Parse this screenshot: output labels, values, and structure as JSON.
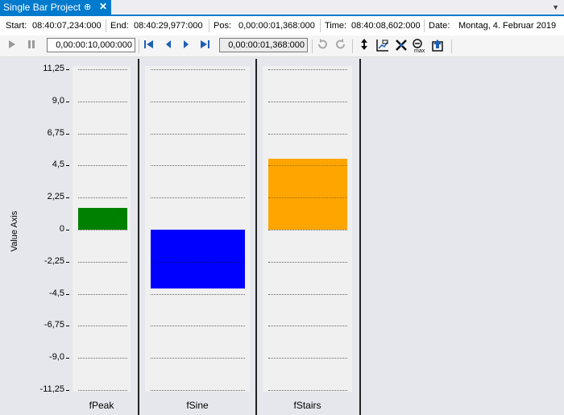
{
  "window": {
    "tab_title": "Single Bar Project",
    "pin_glyph": "⊕",
    "close_glyph": "✕",
    "menu_glyph": "▼"
  },
  "info": {
    "start_label": "Start:",
    "start_value": "08:40:07,234:000",
    "end_label": "End:",
    "end_value": "08:40:29,977:000",
    "pos_label": "Pos:",
    "pos_value": "0,00:00:01,368:000",
    "time_label": "Time:",
    "time_value": "08:40:08,602:000",
    "date_label": "Date:",
    "date_value": "Montag, 4. Februar 2019"
  },
  "toolbar": {
    "time_span_value": "0,00:00:10,000:000",
    "position_value": "0,00:00:01,368:000",
    "icons": [
      "play-icon",
      "pause-icon",
      "skip-first-icon",
      "step-back-icon",
      "step-forward-icon",
      "skip-last-icon",
      "undo-icon",
      "redo-icon",
      "up-down-arrows-icon",
      "axis-edit-icon",
      "crosshair-icon",
      "zoom-max-icon",
      "export-icon"
    ],
    "zoom_label": "max"
  },
  "colors": {
    "fPeak": "#008000",
    "fSine": "#0000ff",
    "fStairs": "#ffa500",
    "accent": "#007acc"
  },
  "chart_data": {
    "type": "bar",
    "ylabel": "Value Axis",
    "ylim": [
      -11.25,
      11.25
    ],
    "yticks": [
      "11,25",
      "9,0",
      "6,75",
      "4,5",
      "2,25",
      "0",
      "-2,25",
      "-4,5",
      "-6,75",
      "-9,0",
      "-11,25"
    ],
    "categories": [
      "fPeak",
      "fSine",
      "fStairs"
    ],
    "values": [
      1.55,
      -4.1,
      4.95
    ],
    "grid": true
  }
}
